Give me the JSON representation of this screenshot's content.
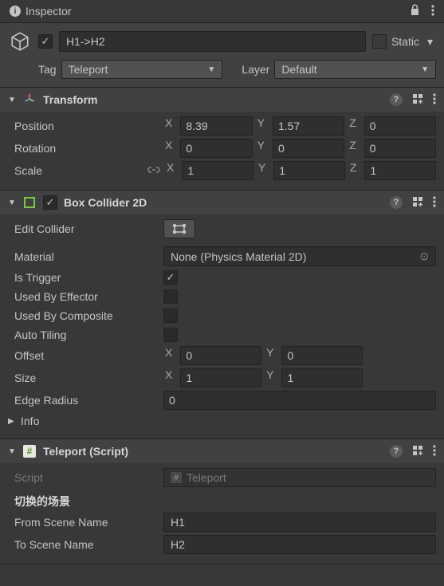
{
  "tab": {
    "title": "Inspector"
  },
  "gameObject": {
    "enabled": true,
    "name": "H1->H2",
    "static_label": "Static",
    "tag_label": "Tag",
    "tag_value": "Teleport",
    "layer_label": "Layer",
    "layer_value": "Default"
  },
  "transform": {
    "title": "Transform",
    "position_label": "Position",
    "position": {
      "x": "8.39",
      "y": "1.57",
      "z": "0"
    },
    "rotation_label": "Rotation",
    "rotation": {
      "x": "0",
      "y": "0",
      "z": "0"
    },
    "scale_label": "Scale",
    "scale": {
      "x": "1",
      "y": "1",
      "z": "1"
    },
    "axis": {
      "x": "X",
      "y": "Y",
      "z": "Z"
    }
  },
  "boxCollider": {
    "title": "Box Collider 2D",
    "enabled": true,
    "edit_collider_label": "Edit Collider",
    "material_label": "Material",
    "material_value": "None (Physics Material 2D)",
    "is_trigger_label": "Is Trigger",
    "is_trigger": true,
    "used_by_effector_label": "Used By Effector",
    "used_by_composite_label": "Used By Composite",
    "auto_tiling_label": "Auto Tiling",
    "offset_label": "Offset",
    "offset": {
      "x": "0",
      "y": "0"
    },
    "size_label": "Size",
    "size": {
      "x": "1",
      "y": "1"
    },
    "edge_radius_label": "Edge Radius",
    "edge_radius": "0",
    "info_label": "Info"
  },
  "teleport": {
    "title": "Teleport (Script)",
    "script_label": "Script",
    "script_value": "Teleport",
    "section_header": "切换的场景",
    "from_label": "From Scene Name",
    "from_value": "H1",
    "to_label": "To Scene Name",
    "to_value": "H2"
  }
}
